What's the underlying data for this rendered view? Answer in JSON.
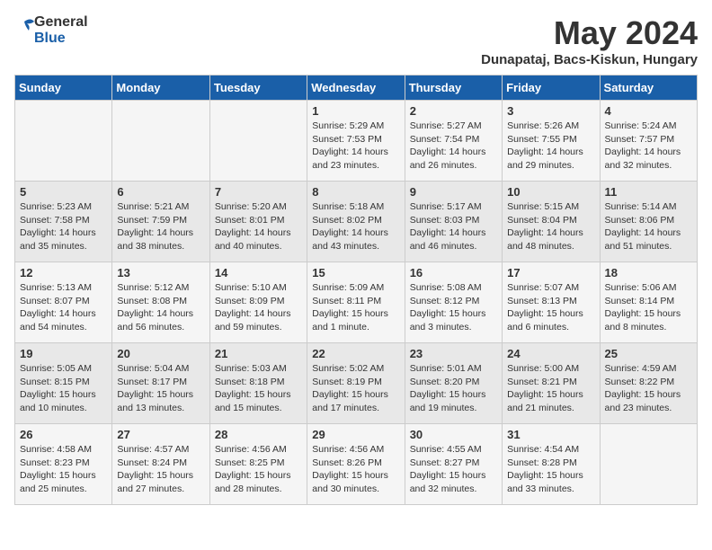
{
  "logo": {
    "general": "General",
    "blue": "Blue"
  },
  "title": "May 2024",
  "subtitle": "Dunapataj, Bacs-Kiskun, Hungary",
  "headers": [
    "Sunday",
    "Monday",
    "Tuesday",
    "Wednesday",
    "Thursday",
    "Friday",
    "Saturday"
  ],
  "weeks": [
    [
      {
        "day": "",
        "info": ""
      },
      {
        "day": "",
        "info": ""
      },
      {
        "day": "",
        "info": ""
      },
      {
        "day": "1",
        "info": "Sunrise: 5:29 AM\nSunset: 7:53 PM\nDaylight: 14 hours\nand 23 minutes."
      },
      {
        "day": "2",
        "info": "Sunrise: 5:27 AM\nSunset: 7:54 PM\nDaylight: 14 hours\nand 26 minutes."
      },
      {
        "day": "3",
        "info": "Sunrise: 5:26 AM\nSunset: 7:55 PM\nDaylight: 14 hours\nand 29 minutes."
      },
      {
        "day": "4",
        "info": "Sunrise: 5:24 AM\nSunset: 7:57 PM\nDaylight: 14 hours\nand 32 minutes."
      }
    ],
    [
      {
        "day": "5",
        "info": "Sunrise: 5:23 AM\nSunset: 7:58 PM\nDaylight: 14 hours\nand 35 minutes."
      },
      {
        "day": "6",
        "info": "Sunrise: 5:21 AM\nSunset: 7:59 PM\nDaylight: 14 hours\nand 38 minutes."
      },
      {
        "day": "7",
        "info": "Sunrise: 5:20 AM\nSunset: 8:01 PM\nDaylight: 14 hours\nand 40 minutes."
      },
      {
        "day": "8",
        "info": "Sunrise: 5:18 AM\nSunset: 8:02 PM\nDaylight: 14 hours\nand 43 minutes."
      },
      {
        "day": "9",
        "info": "Sunrise: 5:17 AM\nSunset: 8:03 PM\nDaylight: 14 hours\nand 46 minutes."
      },
      {
        "day": "10",
        "info": "Sunrise: 5:15 AM\nSunset: 8:04 PM\nDaylight: 14 hours\nand 48 minutes."
      },
      {
        "day": "11",
        "info": "Sunrise: 5:14 AM\nSunset: 8:06 PM\nDaylight: 14 hours\nand 51 minutes."
      }
    ],
    [
      {
        "day": "12",
        "info": "Sunrise: 5:13 AM\nSunset: 8:07 PM\nDaylight: 14 hours\nand 54 minutes."
      },
      {
        "day": "13",
        "info": "Sunrise: 5:12 AM\nSunset: 8:08 PM\nDaylight: 14 hours\nand 56 minutes."
      },
      {
        "day": "14",
        "info": "Sunrise: 5:10 AM\nSunset: 8:09 PM\nDaylight: 14 hours\nand 59 minutes."
      },
      {
        "day": "15",
        "info": "Sunrise: 5:09 AM\nSunset: 8:11 PM\nDaylight: 15 hours\nand 1 minute."
      },
      {
        "day": "16",
        "info": "Sunrise: 5:08 AM\nSunset: 8:12 PM\nDaylight: 15 hours\nand 3 minutes."
      },
      {
        "day": "17",
        "info": "Sunrise: 5:07 AM\nSunset: 8:13 PM\nDaylight: 15 hours\nand 6 minutes."
      },
      {
        "day": "18",
        "info": "Sunrise: 5:06 AM\nSunset: 8:14 PM\nDaylight: 15 hours\nand 8 minutes."
      }
    ],
    [
      {
        "day": "19",
        "info": "Sunrise: 5:05 AM\nSunset: 8:15 PM\nDaylight: 15 hours\nand 10 minutes."
      },
      {
        "day": "20",
        "info": "Sunrise: 5:04 AM\nSunset: 8:17 PM\nDaylight: 15 hours\nand 13 minutes."
      },
      {
        "day": "21",
        "info": "Sunrise: 5:03 AM\nSunset: 8:18 PM\nDaylight: 15 hours\nand 15 minutes."
      },
      {
        "day": "22",
        "info": "Sunrise: 5:02 AM\nSunset: 8:19 PM\nDaylight: 15 hours\nand 17 minutes."
      },
      {
        "day": "23",
        "info": "Sunrise: 5:01 AM\nSunset: 8:20 PM\nDaylight: 15 hours\nand 19 minutes."
      },
      {
        "day": "24",
        "info": "Sunrise: 5:00 AM\nSunset: 8:21 PM\nDaylight: 15 hours\nand 21 minutes."
      },
      {
        "day": "25",
        "info": "Sunrise: 4:59 AM\nSunset: 8:22 PM\nDaylight: 15 hours\nand 23 minutes."
      }
    ],
    [
      {
        "day": "26",
        "info": "Sunrise: 4:58 AM\nSunset: 8:23 PM\nDaylight: 15 hours\nand 25 minutes."
      },
      {
        "day": "27",
        "info": "Sunrise: 4:57 AM\nSunset: 8:24 PM\nDaylight: 15 hours\nand 27 minutes."
      },
      {
        "day": "28",
        "info": "Sunrise: 4:56 AM\nSunset: 8:25 PM\nDaylight: 15 hours\nand 28 minutes."
      },
      {
        "day": "29",
        "info": "Sunrise: 4:56 AM\nSunset: 8:26 PM\nDaylight: 15 hours\nand 30 minutes."
      },
      {
        "day": "30",
        "info": "Sunrise: 4:55 AM\nSunset: 8:27 PM\nDaylight: 15 hours\nand 32 minutes."
      },
      {
        "day": "31",
        "info": "Sunrise: 4:54 AM\nSunset: 8:28 PM\nDaylight: 15 hours\nand 33 minutes."
      },
      {
        "day": "",
        "info": ""
      }
    ]
  ]
}
